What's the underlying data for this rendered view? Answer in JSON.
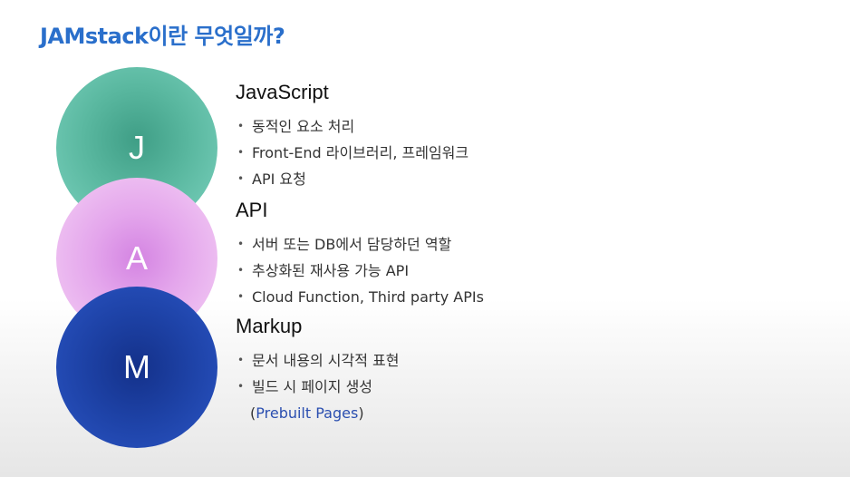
{
  "title": "JAMstack이란 무엇일까?",
  "circles": {
    "j": "J",
    "a": "A",
    "m": "M"
  },
  "sections": {
    "javascript": {
      "heading": "JavaScript",
      "items": [
        "동적인 요소 처리",
        "Front-End 라이브러리, 프레임워크",
        "API 요청"
      ]
    },
    "api": {
      "heading": "API",
      "items": [
        "서버 또는 DB에서 담당하던 역할",
        "추상화된 재사용 가능 API",
        "Cloud Function, Third party APIs"
      ]
    },
    "markup": {
      "heading": "Markup",
      "items": [
        "문서 내용의 시각적 표현",
        "빌드 시 페이지 생성"
      ],
      "note_open": "(",
      "note_link": "Prebuilt Pages",
      "note_close": ")"
    }
  },
  "colors": {
    "title": "#2a6fcb",
    "j_circle": "#5ab8a0",
    "a_circle": "#e4a6ec",
    "m_circle": "#1e43a8",
    "link": "#2b4fb0"
  }
}
